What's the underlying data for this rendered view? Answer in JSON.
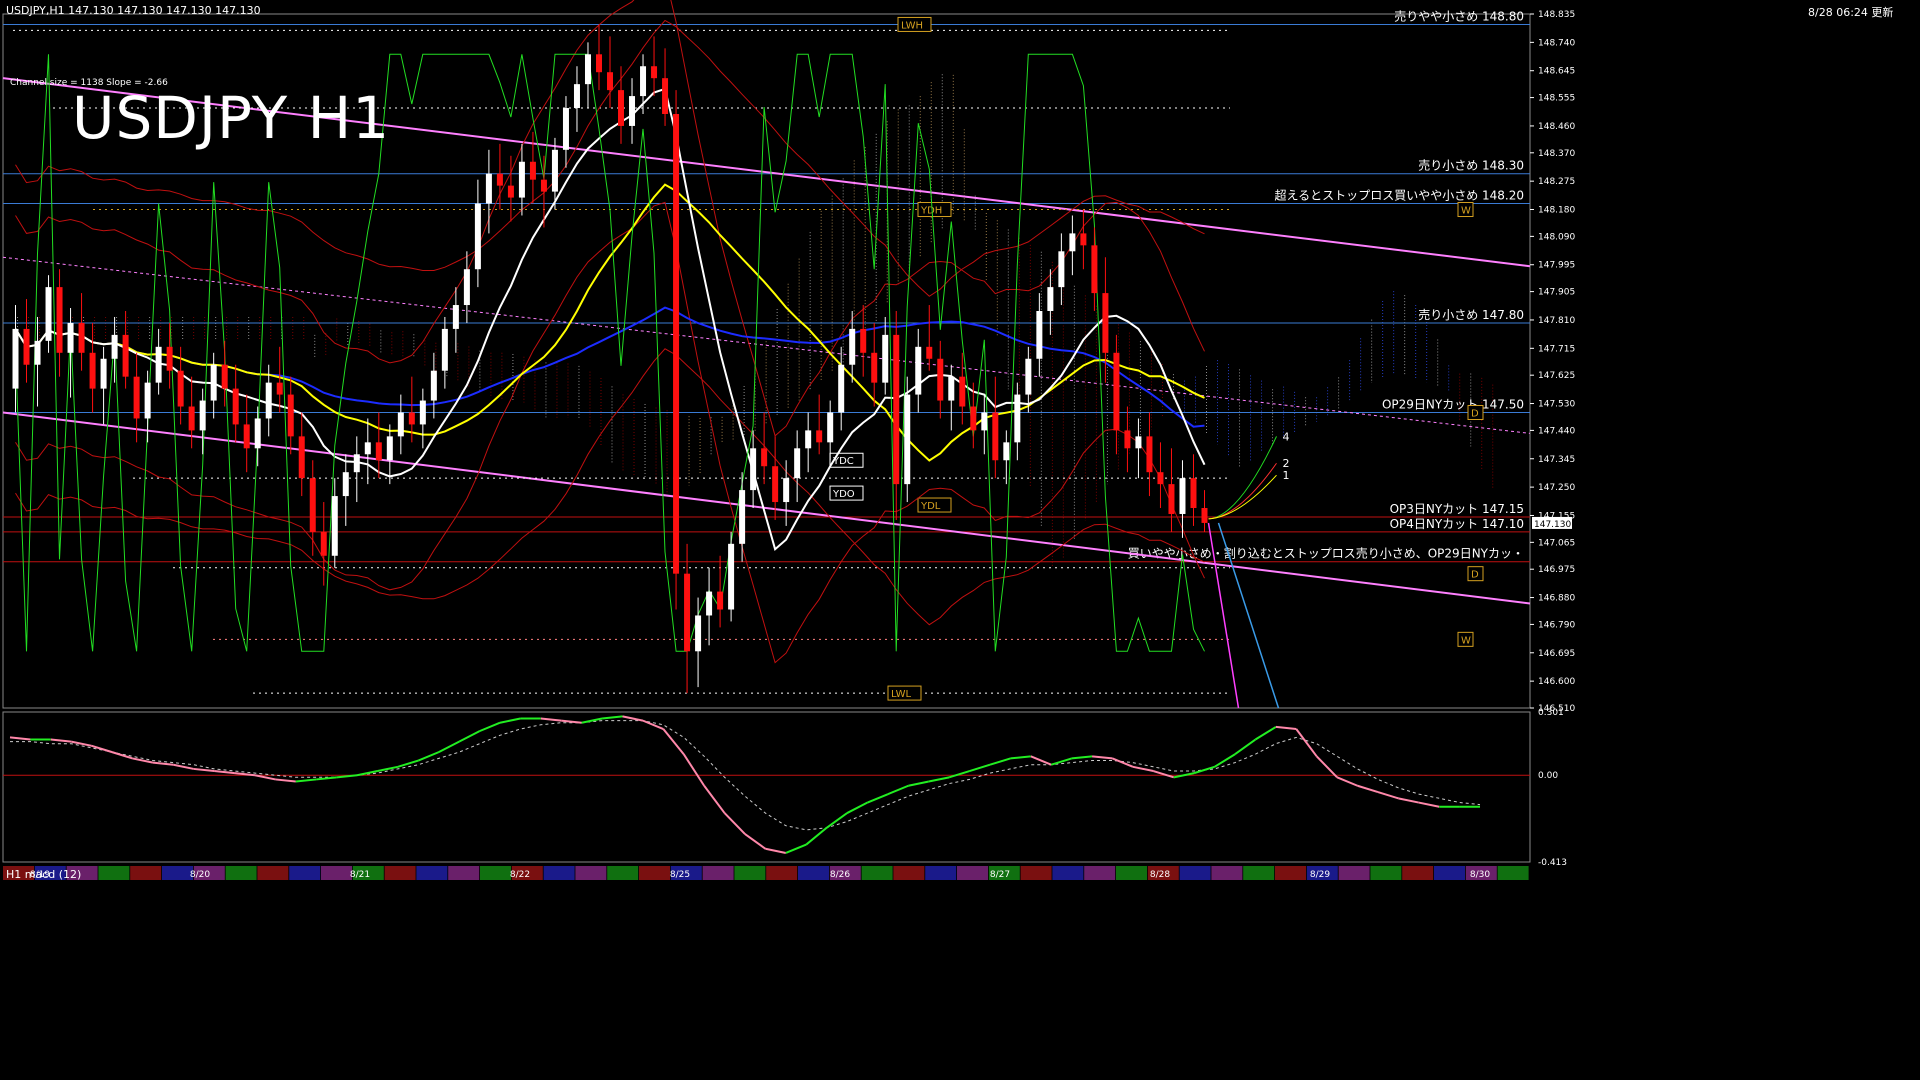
{
  "header": {
    "symbol_info": "USDJPY,H1  147.130 147.130 147.130 147.130",
    "channel_info": "Channel size = 1138 Slope = -2.66",
    "big_title": "USDJPY H1",
    "update_time": "8/28 06:24 更新",
    "sub_label": "H1  macd (12)"
  },
  "colors": {
    "background": "#000000",
    "bull_candle": "#ffffff",
    "bear_candle": "#ff1010",
    "hline_blue": "#3a7bd5",
    "hline_red": "#c01010",
    "channel_magenta": "#ff80ff",
    "ma_white": "#ffffff",
    "ma_yellow": "#ffff00",
    "ma_blue": "#1c2cff",
    "band_red": "#c01010",
    "osc_green": "#22dd22",
    "kumo_white": "#bbbbbb",
    "kumo_red": "#a00000",
    "kumo_blue": "#3050ff",
    "kumo_orange": "#c8a060",
    "axis_text": "#ffffff",
    "macd_up": "#22ee22",
    "macd_down": "#ff88aa",
    "ref_gold": "#d4a020",
    "lower_cyan": "#3a9be8",
    "lower_magenta": "#ff40ff"
  },
  "chart_data": [
    {
      "type": "candlestick",
      "title": "USDJPY H1",
      "ylim": [
        146.51,
        148.835
      ],
      "y_ticks": [
        "148.835",
        "148.740",
        "148.645",
        "148.555",
        "148.460",
        "148.370",
        "148.275",
        "148.180",
        "148.090",
        "147.995",
        "147.905",
        "147.810",
        "147.715",
        "147.625",
        "147.530",
        "147.440",
        "147.345",
        "147.250",
        "147.155",
        "147.065",
        "146.975",
        "146.880",
        "146.790",
        "146.695",
        "146.600",
        "146.510"
      ],
      "current_price": "147.130",
      "x_ticks": [
        "8/19",
        "8/20",
        "8/21",
        "8/22",
        "8/25",
        "8/26",
        "8/27",
        "8/28",
        "8/29",
        "8/30"
      ],
      "candles": [
        [
          147.58,
          147.86,
          147.5,
          147.78
        ],
        [
          147.78,
          147.88,
          147.6,
          147.66
        ],
        [
          147.66,
          147.82,
          147.52,
          147.74
        ],
        [
          147.74,
          147.96,
          147.7,
          147.92
        ],
        [
          147.92,
          147.98,
          147.62,
          147.7
        ],
        [
          147.7,
          147.85,
          147.55,
          147.8
        ],
        [
          147.8,
          147.9,
          147.64,
          147.7
        ],
        [
          147.7,
          147.8,
          147.5,
          147.58
        ],
        [
          147.58,
          147.72,
          147.46,
          147.68
        ],
        [
          147.68,
          147.82,
          147.6,
          147.76
        ],
        [
          147.76,
          147.84,
          147.58,
          147.62
        ],
        [
          147.62,
          147.7,
          147.4,
          147.48
        ],
        [
          147.48,
          147.64,
          147.4,
          147.6
        ],
        [
          147.6,
          147.78,
          147.56,
          147.72
        ],
        [
          147.72,
          147.8,
          147.58,
          147.64
        ],
        [
          147.64,
          147.72,
          147.46,
          147.52
        ],
        [
          147.52,
          147.62,
          147.38,
          147.44
        ],
        [
          147.44,
          147.58,
          147.36,
          147.54
        ],
        [
          147.54,
          147.7,
          147.48,
          147.66
        ],
        [
          147.66,
          147.74,
          147.52,
          147.58
        ],
        [
          147.58,
          147.66,
          147.4,
          147.46
        ],
        [
          147.46,
          147.56,
          147.3,
          147.38
        ],
        [
          147.38,
          147.52,
          147.32,
          147.48
        ],
        [
          147.48,
          147.66,
          147.42,
          147.6
        ],
        [
          147.6,
          147.72,
          147.5,
          147.56
        ],
        [
          147.56,
          147.62,
          147.36,
          147.42
        ],
        [
          147.42,
          147.5,
          147.22,
          147.28
        ],
        [
          147.28,
          147.34,
          147.02,
          147.1
        ],
        [
          147.1,
          147.2,
          146.92,
          147.02
        ],
        [
          147.02,
          147.28,
          146.98,
          147.22
        ],
        [
          147.22,
          147.36,
          147.12,
          147.3
        ],
        [
          147.3,
          147.42,
          147.2,
          147.36
        ],
        [
          147.36,
          147.48,
          147.26,
          147.4
        ],
        [
          147.4,
          147.5,
          147.28,
          147.34
        ],
        [
          147.34,
          147.46,
          147.26,
          147.42
        ],
        [
          147.42,
          147.56,
          147.36,
          147.5
        ],
        [
          147.5,
          147.62,
          147.4,
          147.46
        ],
        [
          147.46,
          147.58,
          147.38,
          147.54
        ],
        [
          147.54,
          147.7,
          147.48,
          147.64
        ],
        [
          147.64,
          147.82,
          147.58,
          147.78
        ],
        [
          147.78,
          147.92,
          147.7,
          147.86
        ],
        [
          147.86,
          148.04,
          147.8,
          147.98
        ],
        [
          147.98,
          148.28,
          147.92,
          148.2
        ],
        [
          148.2,
          148.38,
          148.1,
          148.3
        ],
        [
          148.3,
          148.4,
          148.18,
          148.26
        ],
        [
          148.26,
          148.36,
          148.14,
          148.22
        ],
        [
          148.22,
          148.4,
          148.16,
          148.34
        ],
        [
          148.34,
          148.44,
          148.2,
          148.28
        ],
        [
          148.28,
          148.36,
          148.12,
          148.24
        ],
        [
          148.24,
          148.42,
          148.18,
          148.38
        ],
        [
          148.38,
          148.56,
          148.32,
          148.52
        ],
        [
          148.52,
          148.66,
          148.44,
          148.6
        ],
        [
          148.6,
          148.74,
          148.52,
          148.7
        ],
        [
          148.7,
          148.8,
          148.58,
          148.64
        ],
        [
          148.64,
          148.76,
          148.52,
          148.58
        ],
        [
          148.58,
          148.66,
          148.4,
          148.46
        ],
        [
          148.46,
          148.62,
          148.4,
          148.56
        ],
        [
          148.56,
          148.7,
          148.5,
          148.66
        ],
        [
          148.66,
          148.76,
          148.56,
          148.62
        ],
        [
          148.62,
          148.72,
          148.46,
          148.5
        ],
        [
          148.5,
          148.58,
          146.84,
          146.96
        ],
        [
          146.96,
          147.06,
          146.56,
          146.7
        ],
        [
          146.7,
          146.88,
          146.58,
          146.82
        ],
        [
          146.82,
          146.98,
          146.72,
          146.9
        ],
        [
          146.9,
          147.02,
          146.78,
          146.84
        ],
        [
          146.84,
          147.1,
          146.8,
          147.06
        ],
        [
          147.06,
          147.3,
          147.0,
          147.24
        ],
        [
          147.24,
          147.44,
          147.18,
          147.38
        ],
        [
          147.38,
          147.5,
          147.26,
          147.32
        ],
        [
          147.32,
          147.42,
          147.14,
          147.2
        ],
        [
          147.2,
          147.34,
          147.12,
          147.28
        ],
        [
          147.28,
          147.44,
          147.2,
          147.38
        ],
        [
          147.38,
          147.5,
          147.3,
          147.44
        ],
        [
          147.44,
          147.56,
          147.36,
          147.4
        ],
        [
          147.4,
          147.54,
          147.34,
          147.5
        ],
        [
          147.5,
          147.72,
          147.44,
          147.66
        ],
        [
          147.66,
          147.84,
          147.6,
          147.78
        ],
        [
          147.78,
          147.86,
          147.62,
          147.7
        ],
        [
          147.7,
          147.8,
          147.52,
          147.6
        ],
        [
          147.6,
          147.82,
          147.56,
          147.76
        ],
        [
          147.76,
          147.84,
          147.14,
          147.26
        ],
        [
          147.26,
          147.62,
          147.2,
          147.56
        ],
        [
          147.56,
          147.78,
          147.5,
          147.72
        ],
        [
          147.72,
          147.86,
          147.64,
          147.68
        ],
        [
          147.68,
          147.74,
          147.48,
          147.54
        ],
        [
          147.54,
          147.66,
          147.44,
          147.62
        ],
        [
          147.62,
          147.7,
          147.46,
          147.52
        ],
        [
          147.52,
          147.6,
          147.38,
          147.44
        ],
        [
          147.44,
          147.56,
          147.36,
          147.5
        ],
        [
          147.5,
          147.62,
          147.28,
          147.34
        ],
        [
          147.34,
          147.44,
          147.26,
          147.4
        ],
        [
          147.4,
          147.6,
          147.34,
          147.56
        ],
        [
          147.56,
          147.72,
          147.5,
          147.68
        ],
        [
          147.68,
          147.9,
          147.62,
          147.84
        ],
        [
          147.84,
          147.98,
          147.76,
          147.92
        ],
        [
          147.92,
          148.1,
          147.86,
          148.04
        ],
        [
          148.04,
          148.16,
          147.96,
          148.1
        ],
        [
          148.1,
          148.18,
          147.98,
          148.06
        ],
        [
          148.06,
          148.12,
          147.84,
          147.9
        ],
        [
          147.9,
          148.02,
          147.6,
          147.7
        ],
        [
          147.7,
          147.76,
          147.36,
          147.44
        ],
        [
          147.44,
          147.52,
          147.3,
          147.38
        ],
        [
          147.38,
          147.48,
          147.28,
          147.42
        ],
        [
          147.42,
          147.5,
          147.22,
          147.3
        ],
        [
          147.3,
          147.4,
          147.18,
          147.26
        ],
        [
          147.26,
          147.38,
          147.1,
          147.16
        ],
        [
          147.16,
          147.34,
          147.08,
          147.28
        ],
        [
          147.28,
          147.36,
          147.12,
          147.18
        ],
        [
          147.18,
          147.24,
          147.1,
          147.13
        ]
      ],
      "horizontal_lines": [
        {
          "price": 148.8,
          "label": "売りやや小さめ 148.80",
          "color": "#3a7bd5"
        },
        {
          "price": 148.3,
          "label": "売り小さめ 148.30",
          "color": "#3a7bd5"
        },
        {
          "price": 148.2,
          "label": "超えるとストップロス買いやや小さめ 148.20",
          "color": "#3a7bd5"
        },
        {
          "price": 147.8,
          "label": "売り小さめ 147.80",
          "color": "#3a7bd5"
        },
        {
          "price": 147.5,
          "label": "OP29日NYカット 147.50",
          "color": "#3a7bd5"
        },
        {
          "price": 147.15,
          "label": "OP3日NYカット 147.15",
          "color": "#c01010"
        },
        {
          "price": 147.1,
          "label": "OP4日NYカット 147.10",
          "color": "#c01010"
        },
        {
          "price": 147.0,
          "label": "買いやや小さめ・割り込むとストップロス売り小さめ、OP29日NYカッ・",
          "color": "#c01010"
        }
      ],
      "reference_boxes": [
        "LWH",
        "YDH",
        "W",
        "D",
        "YDC",
        "YDO",
        "YDL",
        "D",
        "W",
        "LWL"
      ],
      "projection_labels": [
        "4",
        "2",
        "1"
      ]
    },
    {
      "type": "line",
      "title": "H1  macd (12)",
      "ylim": [
        -0.413,
        0.301
      ],
      "y_ticks": [
        "0.301",
        "0.00",
        "-0.413"
      ],
      "series": [
        {
          "values": [
            0.18,
            0.17,
            0.17,
            0.16,
            0.14,
            0.11,
            0.08,
            0.06,
            0.05,
            0.03,
            0.02,
            0.01,
            0.0,
            -0.02,
            -0.03,
            -0.02,
            -0.01,
            0.0,
            0.02,
            0.04,
            0.07,
            0.11,
            0.16,
            0.21,
            0.25,
            0.27,
            0.27,
            0.26,
            0.25,
            0.27,
            0.28,
            0.26,
            0.22,
            0.1,
            -0.05,
            -0.18,
            -0.28,
            -0.35,
            -0.37,
            -0.33,
            -0.25,
            -0.18,
            -0.13,
            -0.09,
            -0.05,
            -0.03,
            -0.01,
            0.02,
            0.05,
            0.08,
            0.09,
            0.05,
            0.08,
            0.09,
            0.08,
            0.04,
            0.02,
            -0.01,
            0.01,
            0.04,
            0.1,
            0.17,
            0.23,
            0.22,
            0.09,
            -0.01,
            -0.05,
            -0.08,
            -0.11,
            -0.13,
            -0.15,
            -0.15,
            -0.15
          ]
        },
        {
          "values": [
            0.16,
            0.16,
            0.15,
            0.15,
            0.13,
            0.11,
            0.09,
            0.07,
            0.06,
            0.05,
            0.03,
            0.02,
            0.01,
            0.0,
            -0.01,
            -0.01,
            -0.01,
            0.0,
            0.01,
            0.03,
            0.05,
            0.08,
            0.11,
            0.15,
            0.19,
            0.22,
            0.24,
            0.25,
            0.25,
            0.26,
            0.26,
            0.26,
            0.24,
            0.18,
            0.09,
            -0.01,
            -0.1,
            -0.18,
            -0.24,
            -0.26,
            -0.25,
            -0.22,
            -0.18,
            -0.14,
            -0.1,
            -0.07,
            -0.04,
            -0.02,
            0.01,
            0.03,
            0.05,
            0.05,
            0.06,
            0.07,
            0.07,
            0.06,
            0.04,
            0.02,
            0.02,
            0.03,
            0.06,
            0.1,
            0.15,
            0.18,
            0.15,
            0.09,
            0.03,
            -0.02,
            -0.06,
            -0.09,
            -0.11,
            -0.13,
            -0.14
          ]
        }
      ]
    }
  ]
}
